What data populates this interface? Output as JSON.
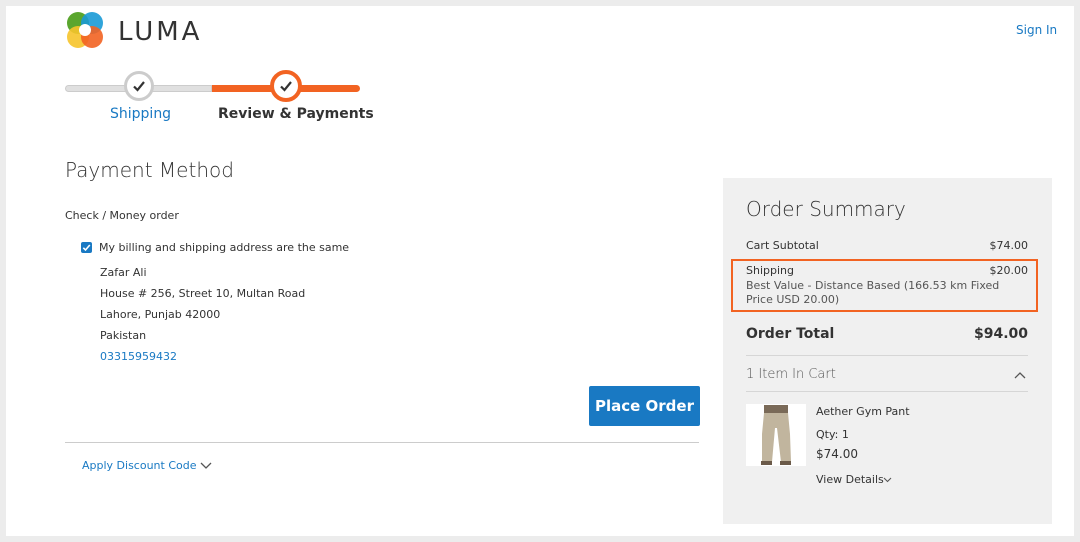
{
  "header": {
    "brand": "LUMA",
    "sign_in": "Sign In"
  },
  "progress": {
    "steps": [
      {
        "label": "Shipping",
        "state": "complete"
      },
      {
        "label": "Review & Payments",
        "state": "active"
      }
    ]
  },
  "payment": {
    "title": "Payment Method",
    "method": "Check / Money order",
    "same_address_label": "My billing and shipping address are the same",
    "same_address_checked": true,
    "address": {
      "name": "Zafar Ali",
      "street": "House # 256, Street 10, Multan Road",
      "city": "Lahore, Punjab 42000",
      "country": "Pakistan",
      "phone": "03315959432"
    },
    "place_order": "Place Order",
    "discount_label": "Apply Discount Code"
  },
  "summary": {
    "title": "Order Summary",
    "subtotal_label": "Cart Subtotal",
    "subtotal_value": "$74.00",
    "shipping_label": "Shipping",
    "shipping_value": "$20.00",
    "shipping_method_line1": "Best Value - Distance Based (166.53 km Fixed",
    "shipping_method_line2": "Price USD 20.00)",
    "total_label": "Order Total",
    "total_value": "$94.00",
    "items_in_cart": "1 Item In Cart",
    "item": {
      "name": "Aether Gym Pant",
      "qty": "Qty: 1",
      "price": "$74.00",
      "details_link": "View Details"
    }
  },
  "colors": {
    "accent": "#f26322",
    "link": "#1979c3",
    "complete": "#cccccc"
  }
}
